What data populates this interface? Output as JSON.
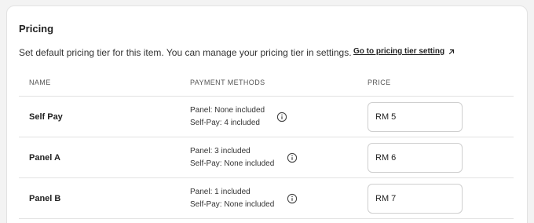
{
  "section": {
    "title": "Pricing",
    "description": "Set default pricing tier for this item. You can manage your pricing tier in settings.",
    "link_label": "Go to pricing tier setting"
  },
  "table": {
    "headers": {
      "name": "NAME",
      "payment_methods": "PAYMENT METHODS",
      "price": "PRICE"
    },
    "rows": [
      {
        "name": "Self Pay",
        "panel": "Panel: None included",
        "self_pay": "Self-Pay: 4 included",
        "price": "RM 5"
      },
      {
        "name": "Panel A",
        "panel": "Panel: 3 included",
        "self_pay": "Self-Pay: None included",
        "price": "RM 6"
      },
      {
        "name": "Panel B",
        "panel": "Panel: 1 included",
        "self_pay": "Self-Pay: None included",
        "price": "RM 7"
      }
    ]
  },
  "icons": {
    "external": "external-link-icon",
    "info": "info-icon"
  }
}
